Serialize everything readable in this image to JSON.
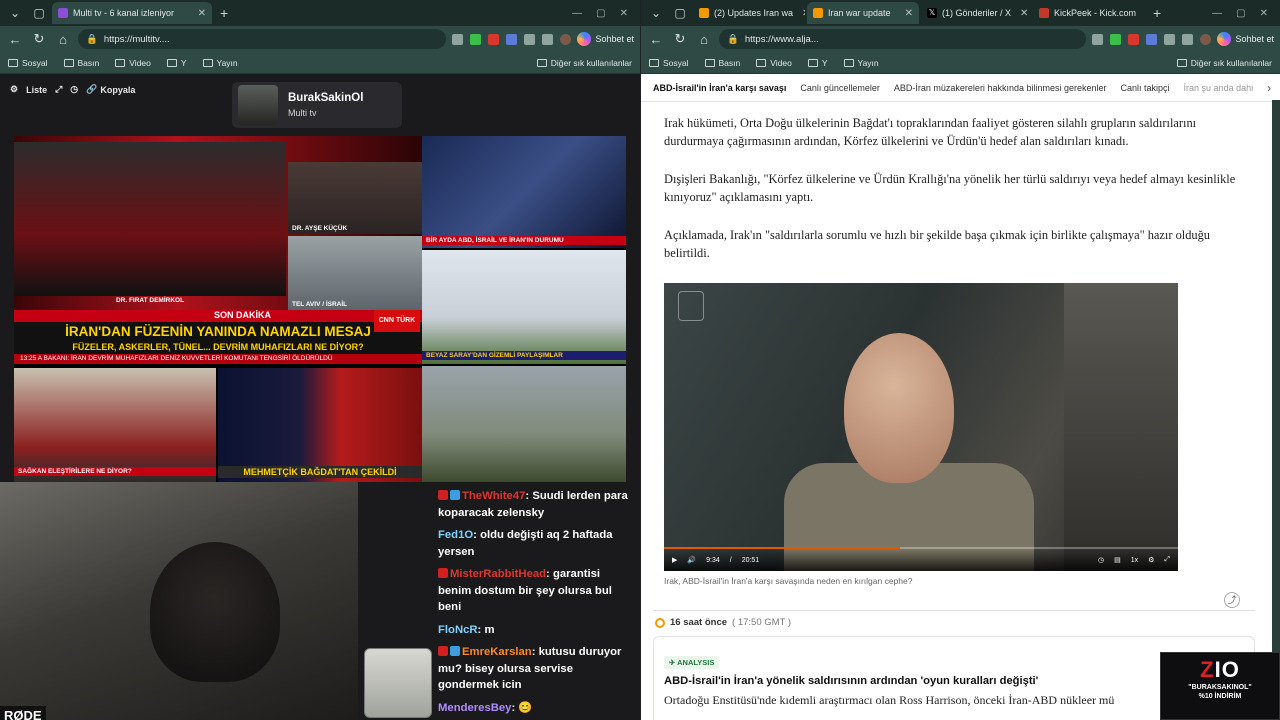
{
  "left_window": {
    "tabs": [
      {
        "label": "Multi tv - 6 kanal izleniyor",
        "active": true
      }
    ],
    "url": "https://multitv....",
    "profile_button": "Sohbet et",
    "bookmarks": [
      "Sosyal",
      "Basın",
      "Video",
      "Y",
      "Yayın"
    ],
    "bookmarks_other": "Diğer sık kullanılanlar",
    "controls": {
      "list": "Liste",
      "copy": "Kopyala"
    },
    "channel": {
      "name": "BurakSakinOl",
      "subtitle": "Multi tv"
    },
    "news": {
      "breaking": "SON DAKİKA",
      "headline": "İRAN'DAN FÜZENİN YANINDA NAMAZLI MESAJ",
      "subline": "FÜZELER, ASKERLER, TÜNEL... DEVRİM MUHAFIZLARI NE DİYOR?",
      "ticker_time": "13:25",
      "ticker": "A BAKANI: İRAN DEVRİM MUHAFIZLARI DENİZ KUVVETLERİ KOMUTANI TENGSİRİ ÖLDÜRÜLDÜ",
      "tile_caption_1": "BİR AYDA ABD, İSRAİL VE İRAN'IN DURUMU",
      "tile_caption_2": "BEYAZ SARAY'DAN GİZEMLİ PAYLAŞIMLAR",
      "tile_caption_3": "SAĞKAN ELEŞTİRİLERE NE DİYOR?",
      "tile_caption_4": "MEHMETÇİK BAĞDAT'TAN ÇEKİLDİ",
      "speaker_1": "DR. FIRAT DEMİRKOL",
      "speaker_2": "DR. AYŞE KÜÇÜK",
      "location": "TEL AVIV / İSRAİL",
      "cnn": "CNN TÜRK"
    },
    "webcam_label": "RØDE",
    "chat": [
      {
        "user": "TheWhite47",
        "text": "Suudi lerden para koparacak zelensky",
        "color": "#e0352f"
      },
      {
        "user": "Fed1O",
        "text": "oldu değişti aq 2 haftada yersen",
        "color": "#7fd3ff"
      },
      {
        "user": "MisterRabbitHead",
        "text": "garantisi benim dostum bir şey olursa bul beni",
        "color": "#e0352f"
      },
      {
        "user": "FloNcR",
        "text": "m",
        "color": "#7fd3ff"
      },
      {
        "user": "EmreKarslan",
        "text": "kutusu duruyor mu? bisey olursa servise gondermek icin",
        "color": "#ff8a1f"
      },
      {
        "user": "MenderesBey",
        "text": "",
        "color": "#b18cff"
      }
    ]
  },
  "right_window": {
    "tabs": [
      {
        "label": "(2) Updates Iran wa",
        "active": false
      },
      {
        "label": "Iran war update",
        "active": true
      },
      {
        "label": "(1) Gönderiler / X",
        "active": false
      },
      {
        "label": "KickPeek - Kick.com",
        "active": false
      }
    ],
    "url": "https://www.alja...",
    "profile_button": "Sohbet et",
    "bookmarks": [
      "Sosyal",
      "Basın",
      "Video",
      "Y",
      "Yayın"
    ],
    "bookmarks_other": "Diğer sık kullanılanlar",
    "subnav": [
      "ABD-İsrail'in İran'a karşı savaşı",
      "Canlı güncellemeler",
      "ABD-İran müzakereleri hakkında bilinmesi gerekenler",
      "Canlı takipçi",
      "İran şu anda dahi"
    ],
    "paragraphs": [
      "Irak hükümeti, Orta Doğu ülkelerinin Bağdat'ı topraklarından faaliyet gösteren silahlı grupların saldırılarını durdurmaya çağırmasının ardından, Körfez ülkelerini ve Ürdün'ü hedef alan saldırıları kınadı.",
      "Dışişleri Bakanlığı, \"Körfez ülkelerine ve Ürdün Krallığı'na yönelik her türlü saldırıyı veya hedef almayı kesinlikle kınıyoruz\" açıklamasını yaptı.",
      "Açıklamada, Irak'ın \"saldırılarla sorumlu ve hızlı bir şekilde başa çıkmak için birlikte çalışmaya\" hazır olduğu belirtildi."
    ],
    "video": {
      "current": "9:34",
      "duration": "20:51",
      "speed": "1x",
      "progress": 0.46
    },
    "video_caption": "Irak, ABD-İsrail'in İran'a karşı savaşında neden en kırılgan cephe?",
    "update_time": "16 saat önce",
    "update_gmt": "( 17:50 GMT )",
    "tag": "ANALYSIS",
    "headline": "ABD-İsrail'in İran'a yönelik saldırısının ardından 'oyun kuralları değişti'",
    "snippet": "Ortadoğu Enstitüsü'nde kıdemli araştırmacı olan Ross Harrison, önceki İran-ABD nükleer mü"
  },
  "promo": {
    "logo": "ZIO",
    "line1": "\"BURAKSAKINOL\"",
    "line2": "%10 İNDİRİM"
  }
}
